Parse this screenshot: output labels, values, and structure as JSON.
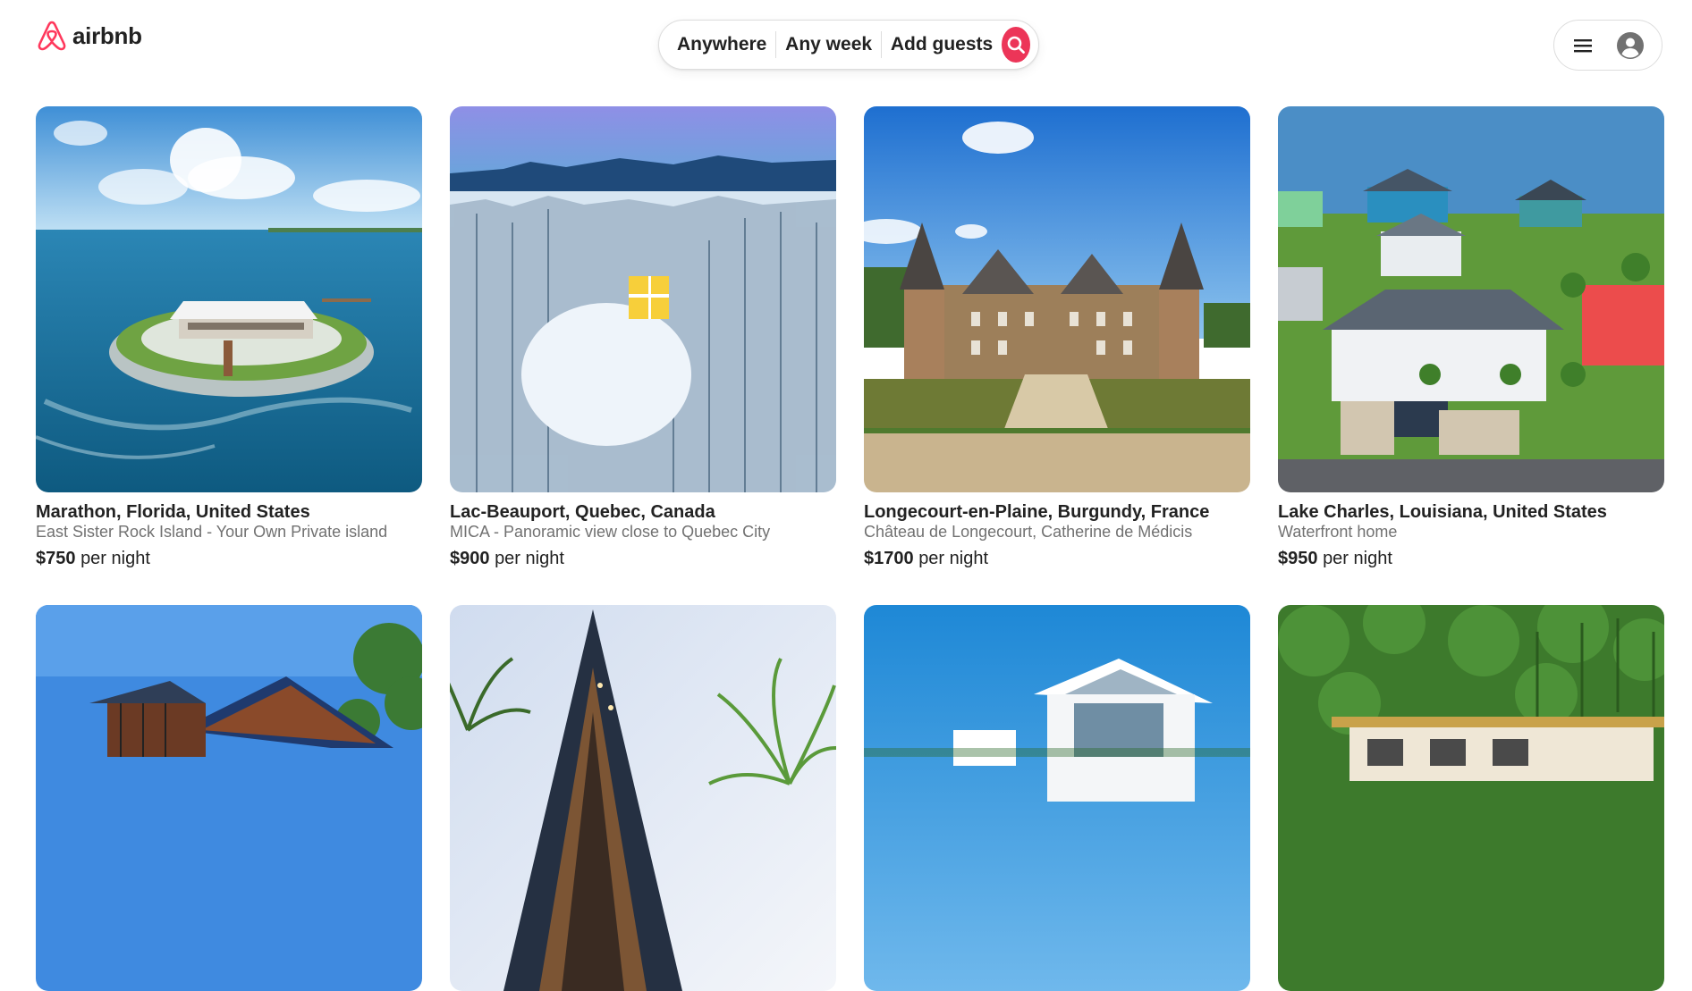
{
  "header": {
    "logo_text": "airbnb",
    "brand_color": "#ff385c",
    "search": {
      "where": "Anywhere",
      "when": "Any week",
      "guests": "Add guests"
    }
  },
  "listings": [
    {
      "location": "Marathon, Florida, United States",
      "description": "East Sister Rock Island - Your Own Private island",
      "price": "$750",
      "price_suffix": "per night",
      "image": "island-house-ocean"
    },
    {
      "location": "Lac-Beauport, Quebec, Canada",
      "description": "MICA - Panoramic view close to Quebec City",
      "price": "$900",
      "price_suffix": "per night",
      "image": "snowy-forest-cabin"
    },
    {
      "location": "Longecourt-en-Plaine, Burgundy, France",
      "description": "Château de Longecourt, Catherine de Médicis",
      "price": "$1700",
      "price_suffix": "per night",
      "image": "french-chateau-moat"
    },
    {
      "location": "Lake Charles, Louisiana, United States",
      "description": "Waterfront home",
      "price": "$950",
      "price_suffix": "per night",
      "image": "waterfront-homes-aerial"
    },
    {
      "location": "",
      "description": "",
      "price": "",
      "price_suffix": "",
      "image": "modern-cabin-trees"
    },
    {
      "location": "",
      "description": "",
      "price": "",
      "price_suffix": "",
      "image": "a-frame-house-palms"
    },
    {
      "location": "",
      "description": "",
      "price": "",
      "price_suffix": "",
      "image": "white-villa-blue-sky"
    },
    {
      "location": "",
      "description": "",
      "price": "",
      "price_suffix": "",
      "image": "jungle-villa-palms"
    }
  ]
}
